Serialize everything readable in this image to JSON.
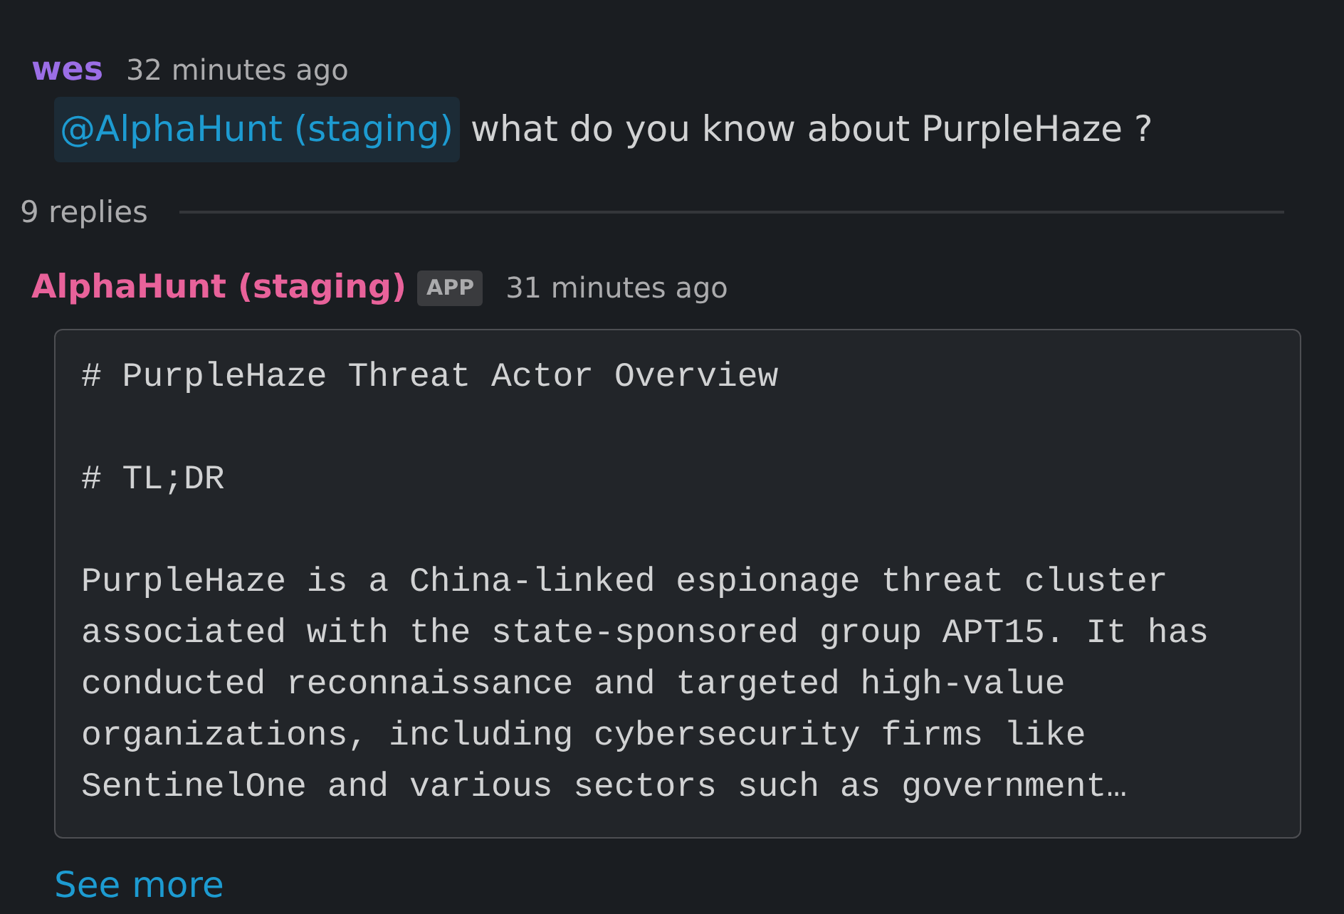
{
  "message": {
    "author": "wes",
    "time": "32 minutes ago",
    "mention": "@AlphaHunt (staging)",
    "text": "what do you know about PurpleHaze ?"
  },
  "thread": {
    "reply_count": "9 replies",
    "replies": [
      {
        "author": "AlphaHunt (staging)",
        "badge": "APP",
        "time": "31 minutes ago",
        "code_block": {
          "paragraphs": [
            "# PurpleHaze Threat Actor Overview",
            "# TL;DR",
            "PurpleHaze is a China-linked espionage threat cluster associated with the state-sponsored group APT15. It has conducted reconnaissance and targeted high-value organizations, including cybersecurity firms like SentinelOne and various sectors such as government…"
          ]
        },
        "see_more": "See more"
      }
    ]
  }
}
